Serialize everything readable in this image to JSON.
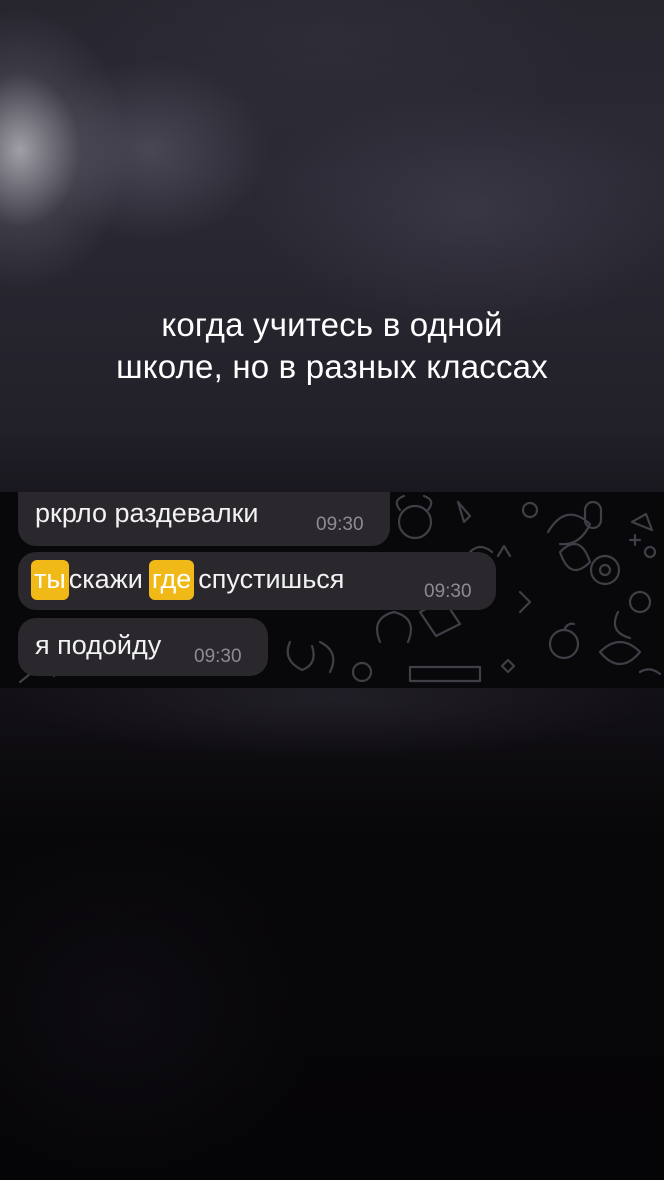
{
  "caption": {
    "line1": "когда учитесь в одной",
    "line2": "школе, но в разных классах"
  },
  "messages": [
    {
      "text": "ркрло раздевалки",
      "time": "09:30"
    },
    {
      "parts": [
        "ты",
        "скажи",
        "где",
        "спустишься"
      ],
      "highlighted": [
        "ты",
        "где"
      ],
      "time": "09:30"
    },
    {
      "text": "я подойду",
      "time": "09:30"
    }
  ],
  "colors": {
    "bubble": "#2a272d",
    "highlight": "#f0b918",
    "timestamp": "#8e8b93",
    "chat_background": "#08070a"
  },
  "icons": [
    "chat-doodle-pattern"
  ]
}
